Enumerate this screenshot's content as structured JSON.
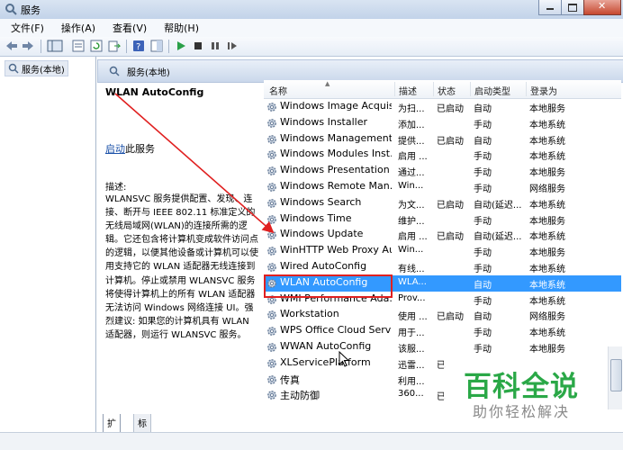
{
  "window": {
    "title": "服务"
  },
  "menu": [
    "文件(F)",
    "操作(A)",
    "查看(V)",
    "帮助(H)"
  ],
  "toolbar_icons": [
    "back-icon",
    "forward-icon",
    "console-tree-icon",
    "properties-icon",
    "refresh-icon",
    "export-icon",
    "help-icon",
    "help-pane-icon",
    "start-service-icon",
    "stop-service-icon",
    "pause-service-icon",
    "restart-service-icon"
  ],
  "tree": {
    "item": "服务(本地)"
  },
  "panel": {
    "header": "服务(本地)"
  },
  "description": {
    "service_title": "WLAN AutoConfig",
    "start_link": "启动",
    "start_suffix": "此服务",
    "label": "描述:",
    "body": "WLANSVC 服务提供配置、发现、连接、断开与 IEEE 802.11 标准定义的无线局域网(WLAN)的连接所需的逻辑。它还包含将计算机变成软件访问点的逻辑，以便其他设备或计算机可以使用支持它的 WLAN 适配器无线连接到计算机。停止或禁用 WLANSVC 服务将使得计算机上的所有 WLAN 适配器无法访问 Windows 网络连接 UI。强烈建议: 如果您的计算机具有 WLAN 适配器，则运行 WLANSVC 服务。"
  },
  "columns": {
    "name": "名称",
    "description": "描述",
    "status": "状态",
    "startup": "启动类型",
    "logon": "登录为"
  },
  "services": [
    {
      "name": "Windows Image Acquis...",
      "description": "为扫...",
      "status": "已启动",
      "startup": "自动",
      "logon": "本地服务"
    },
    {
      "name": "Windows Installer",
      "description": "添加...",
      "status": "",
      "startup": "手动",
      "logon": "本地系统"
    },
    {
      "name": "Windows Management ...",
      "description": "提供...",
      "status": "已启动",
      "startup": "自动",
      "logon": "本地系统"
    },
    {
      "name": "Windows Modules Inst...",
      "description": "启用 ...",
      "status": "",
      "startup": "手动",
      "logon": "本地系统"
    },
    {
      "name": "Windows Presentation ...",
      "description": "通过...",
      "status": "",
      "startup": "手动",
      "logon": "本地服务"
    },
    {
      "name": "Windows Remote Man...",
      "description": "Win...",
      "status": "",
      "startup": "手动",
      "logon": "网络服务"
    },
    {
      "name": "Windows Search",
      "description": "为文...",
      "status": "已启动",
      "startup": "自动(延迟...",
      "logon": "本地系统"
    },
    {
      "name": "Windows Time",
      "description": "维护...",
      "status": "",
      "startup": "手动",
      "logon": "本地服务"
    },
    {
      "name": "Windows Update",
      "description": "启用 ...",
      "status": "已启动",
      "startup": "自动(延迟...",
      "logon": "本地系统"
    },
    {
      "name": "WinHTTP Web Proxy Au...",
      "description": "Win...",
      "status": "",
      "startup": "手动",
      "logon": "本地服务"
    },
    {
      "name": "Wired AutoConfig",
      "description": "有线...",
      "status": "",
      "startup": "手动",
      "logon": "本地系统"
    },
    {
      "name": "WLAN AutoConfig",
      "description": "WLA...",
      "status": "",
      "startup": "自动",
      "logon": "本地系统",
      "selected": true
    },
    {
      "name": "WMI Performance Ada...",
      "description": "Prov...",
      "status": "",
      "startup": "手动",
      "logon": "本地系统"
    },
    {
      "name": "Workstation",
      "description": "使用 ...",
      "status": "已启动",
      "startup": "自动",
      "logon": "网络服务"
    },
    {
      "name": "WPS Office Cloud Service",
      "description": "用于...",
      "status": "",
      "startup": "手动",
      "logon": "本地系统"
    },
    {
      "name": "WWAN AutoConfig",
      "description": "该服...",
      "status": "",
      "startup": "手动",
      "logon": "本地服务"
    },
    {
      "name": "XLServicePlatform",
      "description": "迅雷...",
      "status": "已",
      "startup": "",
      "logon": ""
    },
    {
      "name": "传真",
      "description": "利用...",
      "status": "",
      "startup": "",
      "logon": ""
    },
    {
      "name": "主动防御",
      "description": "360...",
      "status": "已",
      "startup": "",
      "logon": ""
    }
  ],
  "tabs": {
    "extended": "扩展",
    "standard": "标准"
  },
  "watermark": {
    "title": "百科全说",
    "subtitle": "助你轻松解决"
  },
  "colors": {
    "selection": "#3399ff",
    "annotation": "#e02020",
    "watermark": "#2aa847"
  }
}
